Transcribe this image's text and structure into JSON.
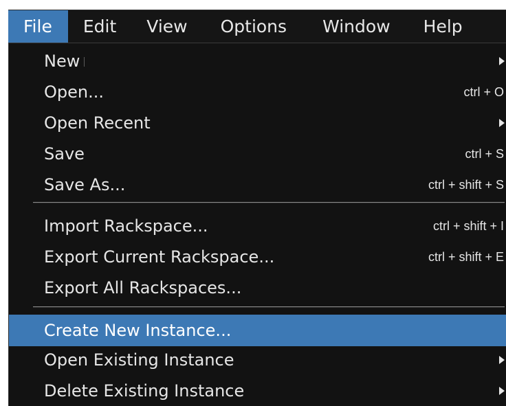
{
  "menubar": {
    "items": [
      {
        "label": "File"
      },
      {
        "label": "Edit"
      },
      {
        "label": "View"
      },
      {
        "label": "Options"
      },
      {
        "label": "Window"
      },
      {
        "label": "Help"
      }
    ]
  },
  "file_menu": {
    "items": [
      {
        "label": "New",
        "shortcut": ""
      },
      {
        "label": "Open...",
        "shortcut": "ctrl + O"
      },
      {
        "label": "Open Recent",
        "shortcut": ""
      },
      {
        "label": "Save",
        "shortcut": "ctrl + S"
      },
      {
        "label": "Save As...",
        "shortcut": "ctrl + shift + S"
      },
      {
        "label": "Import Rackspace...",
        "shortcut": "ctrl + shift + I"
      },
      {
        "label": "Export Current Rackspace...",
        "shortcut": "ctrl + shift + E"
      },
      {
        "label": "Export All Rackspaces...",
        "shortcut": ""
      },
      {
        "label": "Create New Instance...",
        "shortcut": ""
      },
      {
        "label": "Open Existing Instance",
        "shortcut": ""
      },
      {
        "label": "Delete Existing Instance",
        "shortcut": ""
      }
    ]
  },
  "colors": {
    "menu_background": "#121212",
    "highlight": "#3d79b5",
    "text": "#e6e6e6"
  },
  "icons": {
    "submenu_arrow": "triangle-right-icon"
  }
}
